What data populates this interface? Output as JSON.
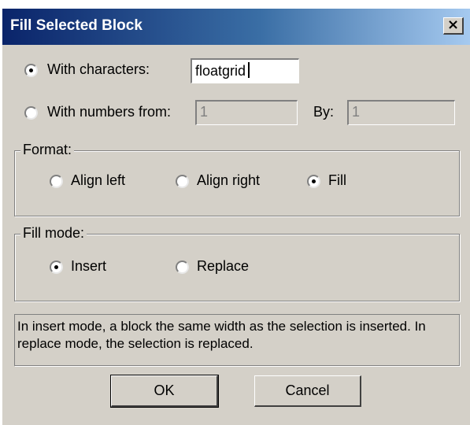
{
  "dialog": {
    "title": "Fill Selected Block",
    "close_glyph": "×"
  },
  "source": {
    "with_characters_label": "With characters:",
    "with_characters_value": "floatgrid",
    "with_characters_selected": true,
    "with_numbers_label": "With numbers from:",
    "with_numbers_value": "1",
    "with_numbers_selected": false,
    "by_label": "By:",
    "by_value": "1"
  },
  "format": {
    "legend": "Format:",
    "align_left": "Align left",
    "align_right": "Align right",
    "fill": "Fill",
    "selected": "fill"
  },
  "fill_mode": {
    "legend": "Fill mode:",
    "insert": "Insert",
    "replace": "Replace",
    "selected": "insert"
  },
  "info_text": "In insert mode, a block the same width as the selection is inserted.  In replace mode, the selection is replaced.",
  "buttons": {
    "ok": "OK",
    "cancel": "Cancel"
  }
}
